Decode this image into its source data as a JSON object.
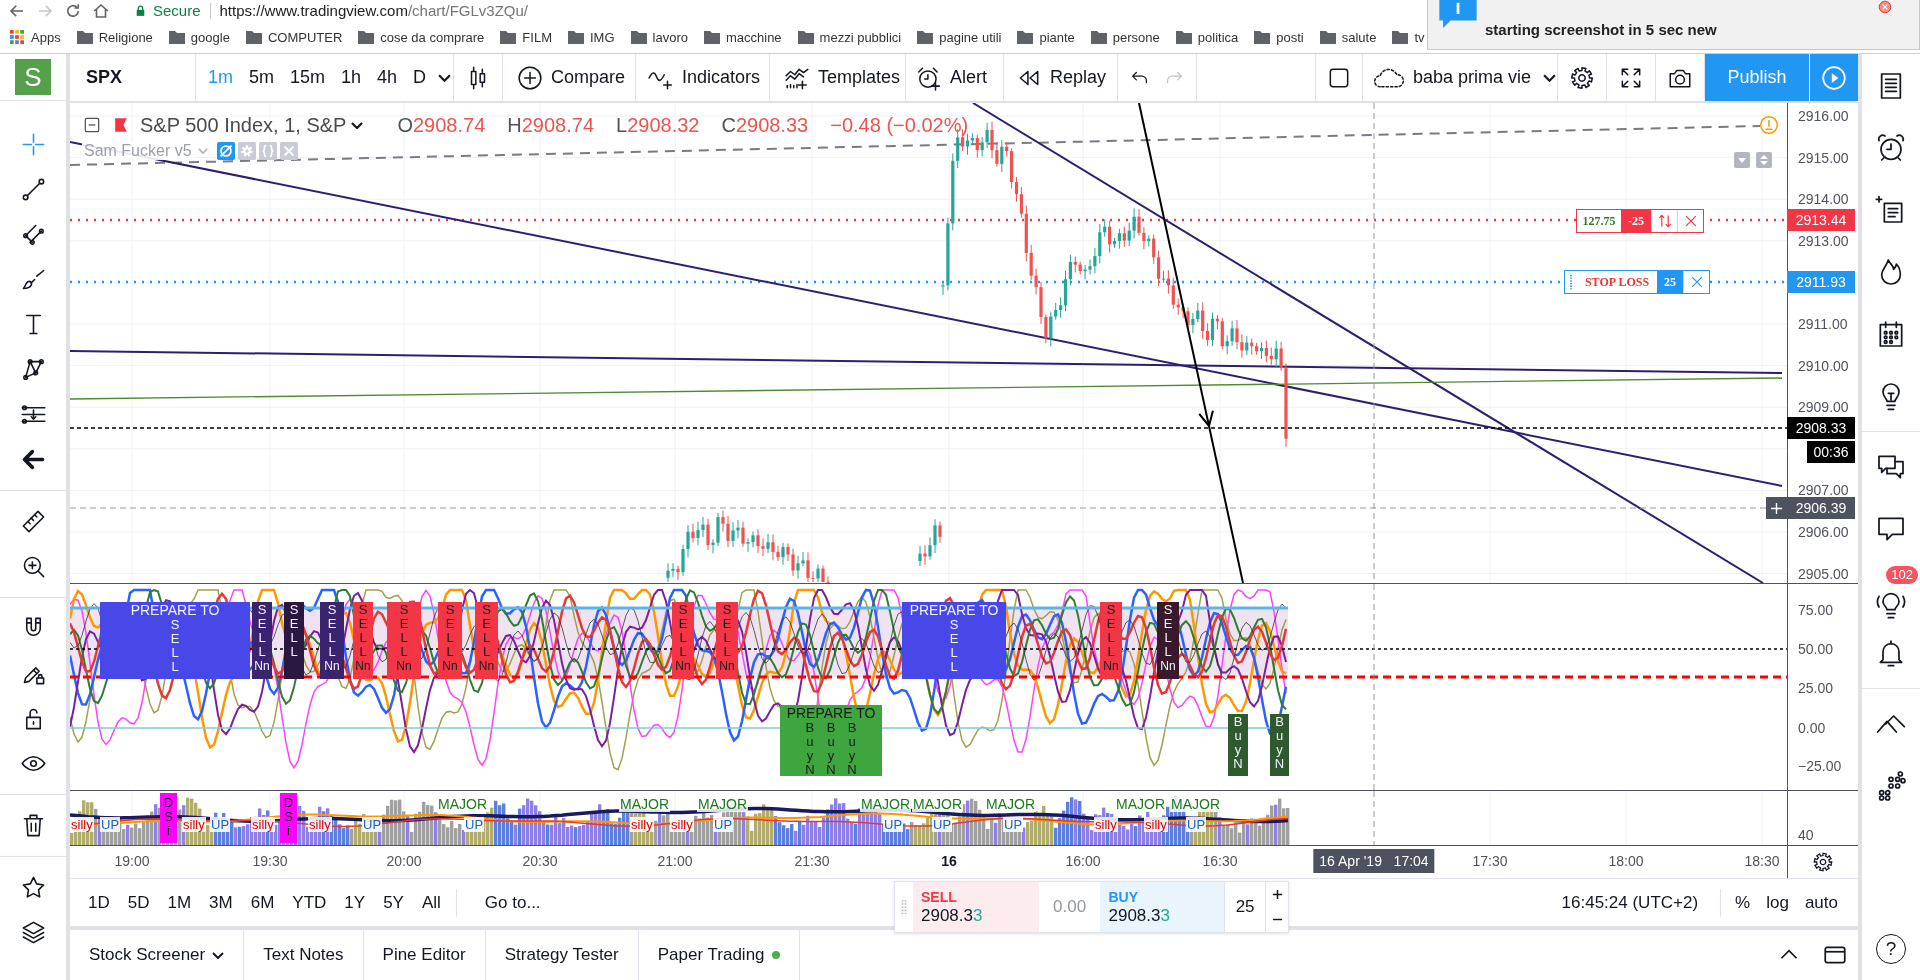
{
  "browser": {
    "secure_label": "Secure",
    "url_host": "https://www.tradingview.com",
    "url_path": "/chart/FGLv3ZQu/",
    "forward_enabled": false,
    "bookmarks": [
      {
        "label": "Apps",
        "kind": "apps"
      },
      {
        "label": "Religione",
        "kind": "folder"
      },
      {
        "label": "google",
        "kind": "folder"
      },
      {
        "label": "COMPUTER",
        "kind": "folder"
      },
      {
        "label": "cose da comprare",
        "kind": "folder"
      },
      {
        "label": "FILM",
        "kind": "folder"
      },
      {
        "label": "IMG",
        "kind": "folder"
      },
      {
        "label": "lavoro",
        "kind": "folder"
      },
      {
        "label": "macchine",
        "kind": "folder"
      },
      {
        "label": "mezzi pubblici",
        "kind": "folder"
      },
      {
        "label": "pagine utili",
        "kind": "folder"
      },
      {
        "label": "piante",
        "kind": "folder"
      },
      {
        "label": "persone",
        "kind": "folder"
      },
      {
        "label": "politica",
        "kind": "folder"
      },
      {
        "label": "posti",
        "kind": "folder"
      },
      {
        "label": "salute",
        "kind": "folder"
      },
      {
        "label": "tv",
        "kind": "folder"
      }
    ]
  },
  "notification": {
    "title": "starting screenshot in 5 sec new"
  },
  "toolbar": {
    "logo": "S",
    "symbol": "SPX",
    "intervals": [
      {
        "label": "1m",
        "selected": true
      },
      {
        "label": "5m",
        "selected": false
      },
      {
        "label": "15m",
        "selected": false
      },
      {
        "label": "1h",
        "selected": false
      },
      {
        "label": "4h",
        "selected": false
      },
      {
        "label": "D",
        "selected": false
      }
    ],
    "compare": "Compare",
    "indicators": "Indicators",
    "templates": "Templates",
    "alert": "Alert",
    "replay": "Replay",
    "undo_enabled": true,
    "redo_enabled": false,
    "layout": "baba prima vie",
    "publish": "Publish"
  },
  "drawing_tools": [
    {
      "selected": true
    },
    {
      "selected": false
    },
    {
      "selected": false
    },
    {
      "selected": false
    },
    {
      "selected": false
    },
    {
      "selected": false
    },
    {
      "selected": false
    }
  ],
  "legend": {
    "title": "S&P 500 Index, 1, S&P",
    "ohlc": [
      {
        "key": "O",
        "value": "2908.74"
      },
      {
        "key": "H",
        "value": "2908.74"
      },
      {
        "key": "L",
        "value": "2908.32"
      },
      {
        "key": "C",
        "value": "2908.33"
      }
    ],
    "change": "−0.48 (−0.02%)",
    "study": "Sam Fucker v5"
  },
  "price_axis": {
    "ticks": [
      "2916.00",
      "2915.00",
      "2914.00",
      "2913.00",
      "2911.00",
      "2910.00",
      "2909.00",
      "2907.00",
      "2906.00",
      "2905.00"
    ],
    "labels": [
      {
        "kind": "order",
        "text": "2913.44"
      },
      {
        "kind": "stop",
        "text": "2911.93"
      },
      {
        "kind": "last",
        "text": "2908.33"
      },
      {
        "kind": "countdown",
        "text": "00:36"
      },
      {
        "kind": "cursor",
        "text": "2906.39"
      }
    ]
  },
  "orders": [
    {
      "kind": "limit",
      "value": "127.75",
      "qty": "-25"
    },
    {
      "kind": "stop",
      "label": "STOP LOSS",
      "qty": "25"
    }
  ],
  "oscillator": {
    "ticks": [
      "75.00",
      "50.00",
      "25.00",
      "0.00",
      "−25.00"
    ],
    "signals": [
      {
        "kind": "prepare",
        "title": "PREPARE TO",
        "columns": [
          "SELL"
        ],
        "color": "#4848e8"
      },
      {
        "kind": "sell",
        "text": "SELL",
        "tag": "Nn",
        "color": "#3a2470"
      },
      {
        "kind": "sell",
        "text": "SELL",
        "color": "#2a1840"
      },
      {
        "kind": "sell",
        "text": "SELL",
        "tag": "Nn",
        "color": "#3a2470"
      },
      {
        "kind": "sell",
        "text": "SELL",
        "tag": "Nn",
        "color": "#f23645"
      },
      {
        "kind": "sell",
        "text": "SELL",
        "tag": "Nn",
        "color": "#f23645"
      },
      {
        "kind": "sell",
        "text": "SELL",
        "tag": "Nn",
        "color": "#f23645"
      },
      {
        "kind": "sell",
        "text": "SELL",
        "tag": "Nn",
        "color": "#f23645"
      },
      {
        "kind": "sell",
        "text": "SELL",
        "tag": "Nn",
        "color": "#f23645"
      },
      {
        "kind": "sell",
        "text": "SELL",
        "tag": "Nn",
        "color": "#f23645"
      },
      {
        "kind": "prepare",
        "title": "PREPARE TO",
        "columns": [
          "BuyN",
          "BuyN",
          "BuyN"
        ],
        "color": "#3fa53f"
      },
      {
        "kind": "prepare",
        "title": "PREPARE TO",
        "columns": [
          "SELL"
        ],
        "color": "#4848e8"
      },
      {
        "kind": "sell",
        "text": "SELL",
        "tag": "Nn",
        "color": "#f23645"
      },
      {
        "kind": "sell",
        "text": "SELL",
        "tag": "Nn",
        "color": "#3a1a2a"
      },
      {
        "kind": "buy",
        "text": "BuyN",
        "color": "#2e5a2e"
      },
      {
        "kind": "buy",
        "text": "BuyN",
        "color": "#2e5a2e"
      }
    ]
  },
  "lower_pane": {
    "ticks": [
      "40"
    ],
    "labels": [
      {
        "kind": "silly",
        "text": "silly"
      },
      {
        "kind": "up",
        "text": "UP"
      },
      {
        "kind": "marker",
        "text": "DSi"
      },
      {
        "kind": "silly",
        "text": "silly"
      },
      {
        "kind": "up",
        "text": "UP"
      },
      {
        "kind": "silly",
        "text": "silly"
      },
      {
        "kind": "marker",
        "text": "DSi"
      },
      {
        "kind": "silly",
        "text": "silly"
      },
      {
        "kind": "up",
        "text": "UP"
      },
      {
        "kind": "major",
        "text": "MAJOR"
      },
      {
        "kind": "up",
        "text": "UP"
      },
      {
        "kind": "major",
        "text": "MAJOR"
      },
      {
        "kind": "silly",
        "text": "silly"
      },
      {
        "kind": "silly",
        "text": "silly"
      },
      {
        "kind": "major",
        "text": "MAJOR"
      },
      {
        "kind": "up",
        "text": "UP"
      },
      {
        "kind": "major",
        "text": "MAJOR"
      },
      {
        "kind": "up",
        "text": "UP"
      },
      {
        "kind": "major",
        "text": "MAJOR"
      },
      {
        "kind": "up",
        "text": "UP"
      },
      {
        "kind": "major",
        "text": "MAJOR"
      },
      {
        "kind": "up",
        "text": "UP"
      },
      {
        "kind": "silly",
        "text": "silly"
      },
      {
        "kind": "major",
        "text": "MAJOR"
      },
      {
        "kind": "silly",
        "text": "silly"
      },
      {
        "kind": "major",
        "text": "MAJOR"
      },
      {
        "kind": "up",
        "text": "UP"
      }
    ]
  },
  "time_axis": {
    "ticks": [
      {
        "label": "19:00",
        "kind": "time"
      },
      {
        "label": "19:30",
        "kind": "time"
      },
      {
        "label": "20:00",
        "kind": "time"
      },
      {
        "label": "20:30",
        "kind": "time"
      },
      {
        "label": "21:00",
        "kind": "time"
      },
      {
        "label": "21:30",
        "kind": "time"
      },
      {
        "label": "16",
        "kind": "day"
      },
      {
        "label": "16:00",
        "kind": "time"
      },
      {
        "label": "16:30",
        "kind": "time"
      },
      {
        "label": "17:30",
        "kind": "time"
      },
      {
        "label": "18:00",
        "kind": "time"
      },
      {
        "label": "18:30",
        "kind": "time"
      }
    ],
    "cursor": "16 Apr '19   17:04"
  },
  "bottom_bar": {
    "ranges": [
      "1D",
      "5D",
      "1M",
      "3M",
      "6M",
      "YTD",
      "1Y",
      "5Y",
      "All"
    ],
    "goto": "Go to...",
    "clock": "16:45:24 (UTC+2)",
    "scale_options": [
      "%",
      "log",
      "auto"
    ]
  },
  "trade": {
    "sell": {
      "label": "SELL",
      "price": "2908.3",
      "price_end": "3"
    },
    "spread": "0.00",
    "buy": {
      "label": "BUY",
      "price": "2908.3",
      "price_end": "3"
    },
    "quantity": "25"
  },
  "bottom_tabs": [
    {
      "label": "Stock Screener",
      "kind": "menu",
      "online": false
    },
    {
      "label": "Text Notes",
      "kind": "tab",
      "online": false
    },
    {
      "label": "Pine Editor",
      "kind": "tab",
      "online": false
    },
    {
      "label": "Strategy Tester",
      "kind": "tab",
      "online": false
    },
    {
      "label": "Paper Trading",
      "kind": "tab",
      "online": true
    }
  ],
  "right_sidebar": {
    "badge": "102",
    "help": "?"
  }
}
